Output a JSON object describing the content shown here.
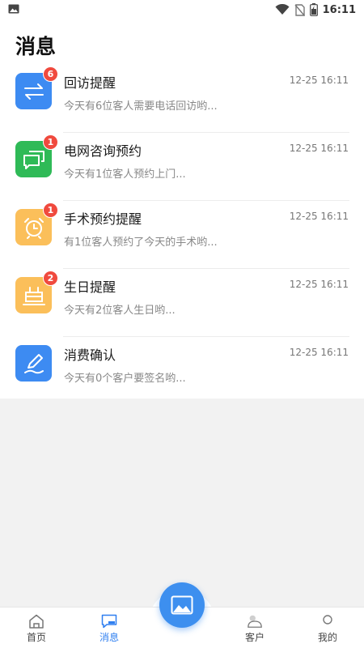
{
  "status_bar": {
    "time": "16:11",
    "icons": [
      "image-icon",
      "wifi-icon",
      "no-sim-icon",
      "battery-icon"
    ]
  },
  "page": {
    "title": "消息"
  },
  "messages": [
    {
      "title": "回访提醒",
      "time": "12-25 16:11",
      "preview": "今天有6位客人需要电话回访哟...",
      "badge": "6",
      "icon": "transfer-arrows-icon",
      "color": "#3d8bf2"
    },
    {
      "title": "电网咨询预约",
      "time": "12-25 16:11",
      "preview": "今天有1位客人预约上门...",
      "badge": "1",
      "icon": "chat-bubbles-icon",
      "color": "#2fba57"
    },
    {
      "title": "手术预约提醒",
      "time": "12-25 16:11",
      "preview": "有1位客人预约了今天的手术哟...",
      "badge": "1",
      "icon": "alarm-clock-icon",
      "color": "#fbbf5a"
    },
    {
      "title": "生日提醒",
      "time": "12-25 16:11",
      "preview": "今天有2位客人生日哟...",
      "badge": "2",
      "icon": "cake-icon",
      "color": "#fbbf5a"
    },
    {
      "title": "消费确认",
      "time": "12-25 16:11",
      "preview": "今天有0个客户要签名哟...",
      "badge": "",
      "icon": "pen-sign-icon",
      "color": "#3d8bf2"
    }
  ],
  "nav": {
    "items": [
      {
        "label": "首页",
        "icon": "home-icon",
        "active": false
      },
      {
        "label": "消息",
        "icon": "message-icon",
        "active": true
      },
      {
        "label": "客户",
        "icon": "customer-icon",
        "active": false
      },
      {
        "label": "我的",
        "icon": "profile-icon",
        "active": false
      }
    ],
    "center_icon": "gallery-icon",
    "active_color": "#2f7ff0"
  }
}
